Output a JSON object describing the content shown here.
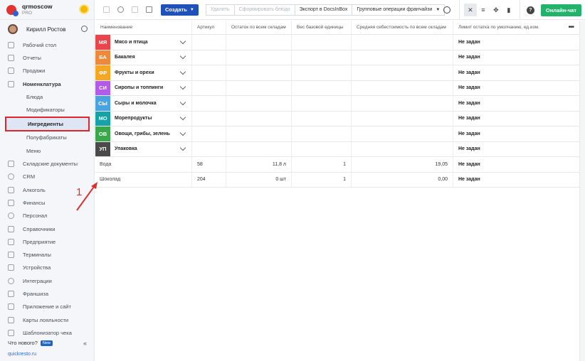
{
  "brand": {
    "name": "qrmoscow",
    "sub": "PRO"
  },
  "user": {
    "name": "Кирилл Ростов"
  },
  "sidebar": {
    "items": [
      {
        "label": "Рабочий стол",
        "icon": "home-icon"
      },
      {
        "label": "Отчеты",
        "icon": "chart-icon"
      },
      {
        "label": "Продажи",
        "icon": "basket-icon"
      },
      {
        "label": "Номенклатура",
        "icon": "tag-icon"
      }
    ],
    "subitems": [
      "Блюда",
      "Модификаторы",
      "Ингредиенты",
      "Полуфабрикаты",
      "Меню"
    ],
    "items2": [
      {
        "label": "Складские документы",
        "icon": "box-icon"
      },
      {
        "label": "CRM",
        "icon": "people-icon"
      },
      {
        "label": "Алкоголь",
        "icon": "glass-icon"
      },
      {
        "label": "Финансы",
        "icon": "wallet-icon"
      },
      {
        "label": "Персонал",
        "icon": "person-icon"
      },
      {
        "label": "Справочники",
        "icon": "book-icon"
      },
      {
        "label": "Предприятие",
        "icon": "building-icon"
      },
      {
        "label": "Терминалы",
        "icon": "terminal-icon"
      },
      {
        "label": "Устройства",
        "icon": "printer-icon"
      },
      {
        "label": "Интеграции",
        "icon": "plug-icon"
      },
      {
        "label": "Франшиза",
        "icon": "network-icon"
      },
      {
        "label": "Приложение и сайт",
        "icon": "phone-icon"
      },
      {
        "label": "Карты лояльности",
        "icon": "card-icon"
      },
      {
        "label": "Шаблонизатор чека",
        "icon": "receipt-icon"
      }
    ],
    "whats_new": "Что нового?",
    "new_badge": "New",
    "collapse": "«",
    "site": "quickresto.ru"
  },
  "toolbar": {
    "create": "Создать",
    "delete": "Удалить",
    "make_dish": "Сформировать блюдо",
    "export": "Экспорт в DocsInBox",
    "franchise": "Групповые операции франчайзи",
    "chat": "Онлайн-чат"
  },
  "table": {
    "headers": [
      "Наименование",
      "Артикул",
      "Остаток по всем складам",
      "Вес базовой единицы",
      "Средняя себестоимость по всем складам",
      "Лимит остатка по умолчанию, ед.изм."
    ],
    "categories": [
      {
        "abbr": "МЯ",
        "name": "Мясо и птица",
        "color": "#e8454d",
        "limit": "Не задан"
      },
      {
        "abbr": "БА",
        "name": "Бакалея",
        "color": "#f0883a",
        "limit": "Не задан"
      },
      {
        "abbr": "ФР",
        "name": "Фрукты и орехи",
        "color": "#f5a623",
        "limit": "Не задан"
      },
      {
        "abbr": "СИ",
        "name": "Сиропы и топпинги",
        "color": "#b15ce6",
        "limit": "Не задан"
      },
      {
        "abbr": "СЫ",
        "name": "Сыры и молочка",
        "color": "#4aa3e0",
        "limit": "Не задан"
      },
      {
        "abbr": "МО",
        "name": "Морепродукты",
        "color": "#16a3a8",
        "limit": "Не задан"
      },
      {
        "abbr": "ОВ",
        "name": "Овощи, грибы, зелень",
        "color": "#3aa84a",
        "limit": "Не задан"
      },
      {
        "abbr": "УП",
        "name": "Упаковка",
        "color": "#4a4a4a",
        "limit": "Не задан"
      }
    ],
    "items": [
      {
        "name": "Вода",
        "article": "58",
        "stock": "11,8 л",
        "weight": "1",
        "cost": "19,05",
        "limit": "Не задан"
      },
      {
        "name": "Шоколад",
        "article": "204",
        "stock": "0 шт",
        "weight": "1",
        "cost": "0,00",
        "limit": "Не задан"
      }
    ]
  },
  "annotation": {
    "number": "1",
    "color": "#d9312b"
  }
}
